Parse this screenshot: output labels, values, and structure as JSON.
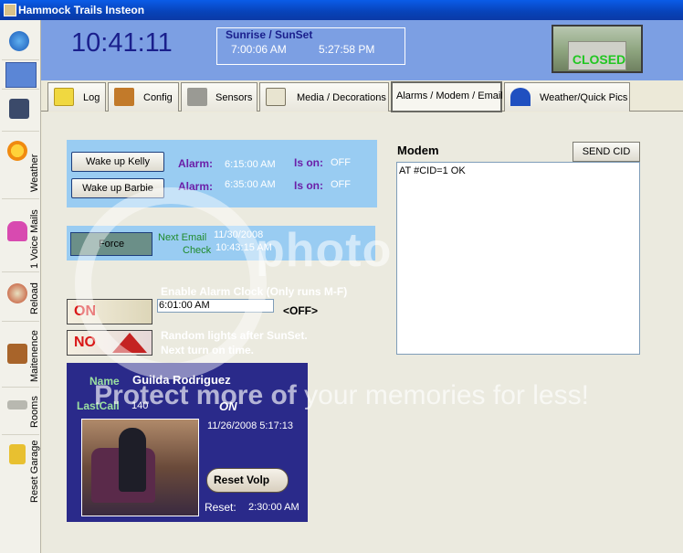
{
  "window": {
    "title": "Hammock Trails Insteon"
  },
  "header": {
    "clock": "10:41:11",
    "sun_title": "Sunrise / SunSet",
    "sunrise": "7:00:06 AM",
    "sunset": "5:27:58 PM",
    "garage_status": "CLOSED"
  },
  "leftnav": {
    "items": [
      {
        "label": "",
        "icon": "refresh-icon"
      },
      {
        "label": "",
        "icon": "blank-icon"
      },
      {
        "label": "",
        "icon": "computer-icon"
      },
      {
        "label": "Weather",
        "icon": "sun-icon"
      },
      {
        "label": "1 Voice Mails",
        "icon": "phone-icon"
      },
      {
        "label": "Reload",
        "icon": "reload-icon"
      },
      {
        "label": "Maitenence",
        "icon": "wrench-icon"
      },
      {
        "label": "Rooms",
        "icon": "plug-icon"
      },
      {
        "label": "Reset Garage",
        "icon": "lock-icon"
      }
    ]
  },
  "tabs": [
    {
      "label": "Log",
      "icon": "log-icon"
    },
    {
      "label": "Config",
      "icon": "config-icon"
    },
    {
      "label": "Sensors",
      "icon": "sensor-icon"
    },
    {
      "label": "Media / Decorations",
      "icon": "media-icon"
    },
    {
      "label": "Alarms / Modem / Email",
      "icon": ""
    },
    {
      "label": "Weather/Quick Pics",
      "icon": "umbrella-icon"
    }
  ],
  "alarms": {
    "rows": [
      {
        "button": "Wake up Kelly",
        "alarm_label": "Alarm:",
        "time": "6:15:00 AM",
        "ison_label": "Is on:",
        "ison": "OFF"
      },
      {
        "button": "Wake up Barbie",
        "alarm_label": "Alarm:",
        "time": "6:35:00 AM",
        "ison_label": "Is on:",
        "ison": "OFF"
      }
    ]
  },
  "email": {
    "force_button": "Force",
    "next_label": "Next Email",
    "next_value": "11/30/2008",
    "check_label": "Check",
    "check_value": "10:43:15 AM"
  },
  "alarm_clock": {
    "on_label": "ON",
    "no_label": "NO",
    "enable_label": "Enable Alarm Clock (Only runs M-F)",
    "time": "6:01:00 AM",
    "status": "<OFF>",
    "random_label": "Random lights after SunSet. Next turn on time."
  },
  "modem": {
    "title": "Modem",
    "send_button": "SEND CID",
    "log": "AT #CID=1 OK"
  },
  "caller": {
    "name_label": "Name",
    "name": "Guilda Rodriguez",
    "lastcall_label": "LastCall",
    "number": "140",
    "on_label": "ON",
    "datetime": "11/26/2008 5:17:13",
    "reset_button": "Reset Volp",
    "reset_label": "Reset:",
    "reset_time": "2:30:00 AM"
  },
  "watermark": {
    "brand": "photo",
    "banner_bold": "Protect more of",
    "banner_rest": "your memories for less!"
  }
}
